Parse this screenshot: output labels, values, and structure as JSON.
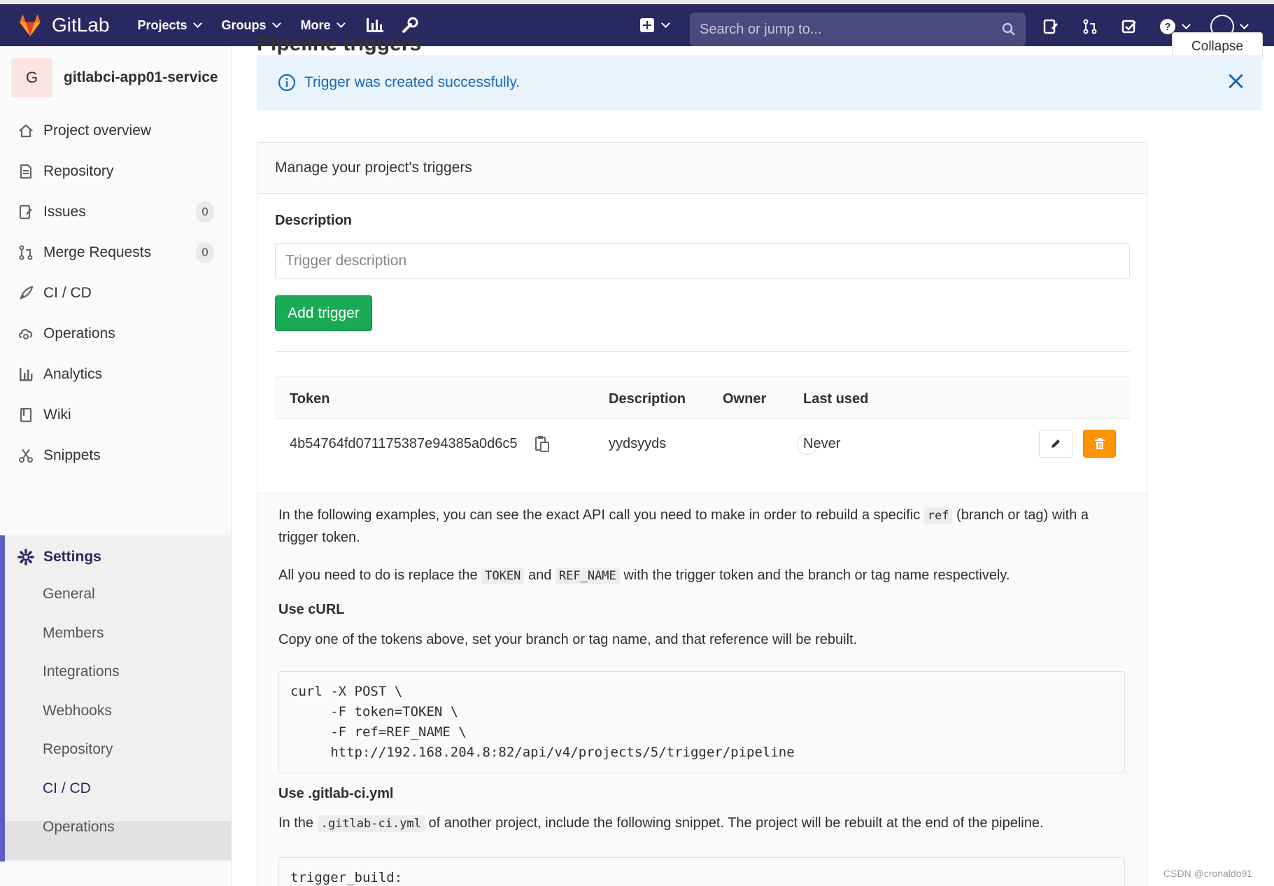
{
  "navbar": {
    "brand": "GitLab",
    "menu": [
      "Projects",
      "Groups",
      "More"
    ],
    "search_placeholder": "Search or jump to..."
  },
  "sidebar": {
    "project_initial": "G",
    "project_name": "gitlabci-app01-service",
    "items": [
      {
        "label": "Project overview",
        "icon": "home-icon"
      },
      {
        "label": "Repository",
        "icon": "document-icon"
      },
      {
        "label": "Issues",
        "icon": "issues-icon",
        "count": "0"
      },
      {
        "label": "Merge Requests",
        "icon": "merge-request-icon",
        "count": "0"
      },
      {
        "label": "CI / CD",
        "icon": "rocket-icon"
      },
      {
        "label": "Operations",
        "icon": "cloud-gear-icon"
      },
      {
        "label": "Analytics",
        "icon": "chart-icon"
      },
      {
        "label": "Wiki",
        "icon": "book-icon"
      },
      {
        "label": "Snippets",
        "icon": "scissors-icon"
      }
    ],
    "settings": {
      "label": "Settings",
      "subitems": [
        "General",
        "Members",
        "Integrations",
        "Webhooks",
        "Repository",
        "CI / CD",
        "Operations"
      ],
      "active": "CI / CD"
    }
  },
  "page": {
    "title_clipped": "Pipeline triggers",
    "collapse_label": "Collapse"
  },
  "flash": {
    "message": "Trigger was created successfully."
  },
  "card": {
    "header": "Manage your project's triggers",
    "description_label": "Description",
    "description_placeholder": "Trigger description",
    "add_button": "Add trigger",
    "table": {
      "headers": [
        "Token",
        "Description",
        "Owner",
        "Last used"
      ],
      "rows": [
        {
          "token": "4b54764fd071175387e94385a0d6c5",
          "description": "yydsyyds",
          "owner": "",
          "last_used": "Never"
        }
      ]
    },
    "examples": {
      "intro_1": "In the following examples, you can see the exact API call you need to make in order to rebuild a specific",
      "intro_code": "ref",
      "intro_2": "(branch or tag) with a trigger token.",
      "replace_1": "All you need to do is replace the",
      "replace_code_1": "TOKEN",
      "replace_and": "and",
      "replace_code_2": "REF_NAME",
      "replace_2": "with the trigger token and the branch or tag name respectively.",
      "curl_heading": "Use cURL",
      "curl_desc": "Copy one of the tokens above, set your branch or tag name, and that reference will be rebuilt.",
      "curl_code": "curl -X POST \\\n     -F token=TOKEN \\\n     -F ref=REF_NAME \\\n     http://192.168.204.8:82/api/v4/projects/5/trigger/pipeline",
      "yml_heading": "Use .gitlab-ci.yml",
      "yml_desc_1": "In the",
      "yml_desc_code": ".gitlab-ci.yml",
      "yml_desc_2": "of another project, include the following snippet. The project will be rebuilt at the end of the pipeline.",
      "yml_code": "trigger_build:"
    }
  },
  "watermark": "CSDN @cronaldo91"
}
